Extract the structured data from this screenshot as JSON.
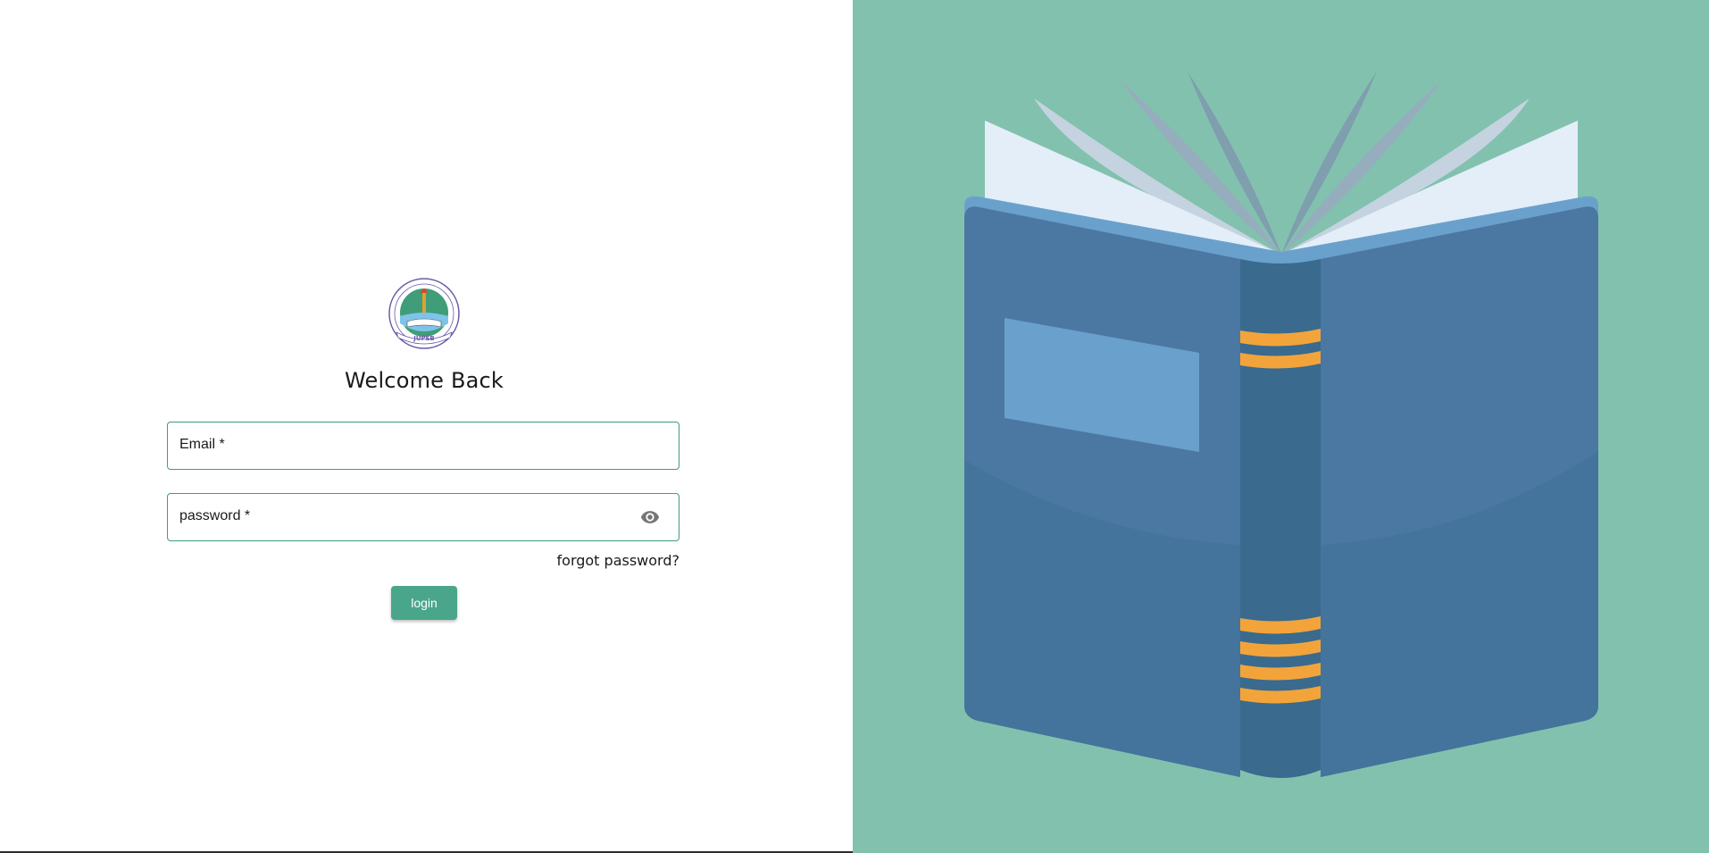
{
  "login": {
    "logo_text": "JUPEB",
    "title": "Welcome Back",
    "email_label": "Email *",
    "password_label": "password *",
    "forgot_link": "forgot password?",
    "login_button": "login"
  },
  "icons": {
    "password_toggle": "eye-icon",
    "illustration": "open-book"
  },
  "colors": {
    "accent": "#4aa68a",
    "field_border": "#3f9d79",
    "illustration_bg": "#82c1ae",
    "book_cover": "#4a78a2",
    "book_spine": "#3a6a8e",
    "book_stripes": "#f2a43a"
  }
}
